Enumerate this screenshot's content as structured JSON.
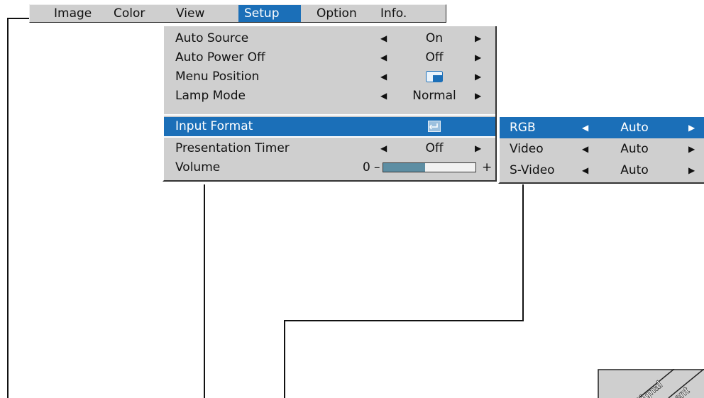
{
  "menubar": {
    "tabs": [
      "Image",
      "Color",
      "View",
      "Setup",
      "Option",
      "Info."
    ],
    "active_tab": "Setup"
  },
  "setup_menu": {
    "items": [
      {
        "label": "Auto Source",
        "value": "On"
      },
      {
        "label": "Auto Power Off",
        "value": "Off"
      },
      {
        "label": "Menu Position",
        "value": ""
      },
      {
        "label": "Lamp Mode",
        "value": "Normal"
      },
      {
        "label": "Input Format",
        "value": ""
      },
      {
        "label": "Presentation Timer",
        "value": "Off"
      },
      {
        "label": "Volume",
        "value": "0"
      }
    ],
    "volume": {
      "value": "0",
      "minus": "–",
      "plus": "+",
      "level_fraction": 0.45
    }
  },
  "input_format_submenu": {
    "items": [
      {
        "label": "RGB",
        "value": "Auto"
      },
      {
        "label": "Video",
        "value": "Auto"
      },
      {
        "label": "S-Video",
        "value": "Auto"
      }
    ]
  },
  "corner_badge": {
    "line1": "Signal",
    "line2": "nent"
  },
  "icons": {
    "left_arrow": "◀",
    "right_arrow": "▶",
    "enter": "enter-icon",
    "menu_position": "menu-position-icon"
  },
  "colors": {
    "highlight": "#1b6fb8",
    "menu_bg": "#cfcfcf",
    "slider_fill": "#5d8ea3"
  }
}
